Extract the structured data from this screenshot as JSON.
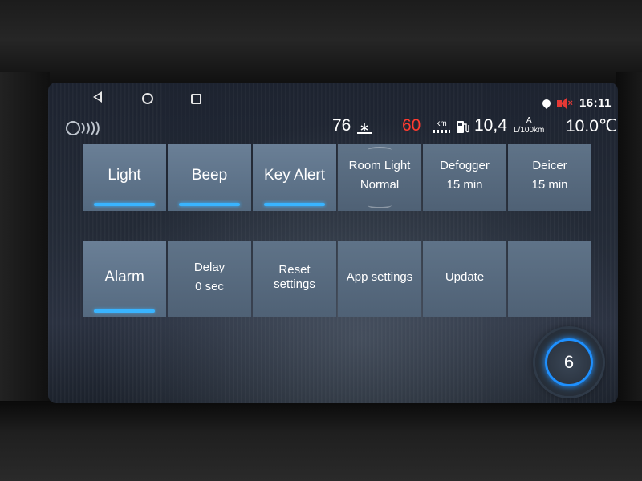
{
  "status_bar": {
    "nav": [
      "back-icon",
      "home-icon",
      "recent-apps-icon"
    ],
    "icons": [
      "location-icon",
      "volume-muted-icon"
    ],
    "time": "16:11"
  },
  "info_bar": {
    "outside_temp": "76",
    "speed": "60",
    "speed_unit": "km",
    "consumption": "10,4",
    "consumption_mode": "A",
    "consumption_unit": "L/100km",
    "inside_temp": "10.0℃",
    "colors": {
      "speed": "#ff3b30",
      "text": "#ffffff"
    }
  },
  "settings_tabs_top": [
    {
      "label": "Light",
      "active": true
    },
    {
      "label": "Beep",
      "active": true
    },
    {
      "label": "Key Alert",
      "active": true
    },
    {
      "label": "Room Light",
      "value": "Normal"
    },
    {
      "label": "Defogger",
      "value": "15 min"
    },
    {
      "label": "Deicer",
      "value": "15 min"
    }
  ],
  "settings_tabs_bottom": [
    {
      "label": "Alarm",
      "active": true
    },
    {
      "label": "Delay",
      "value": "0 sec"
    },
    {
      "label": "Reset settings"
    },
    {
      "label": "App settings"
    },
    {
      "label": "Update"
    },
    {
      "label": ""
    }
  ],
  "page_dial": {
    "number": "6"
  },
  "accent_color": "#39b4ff"
}
